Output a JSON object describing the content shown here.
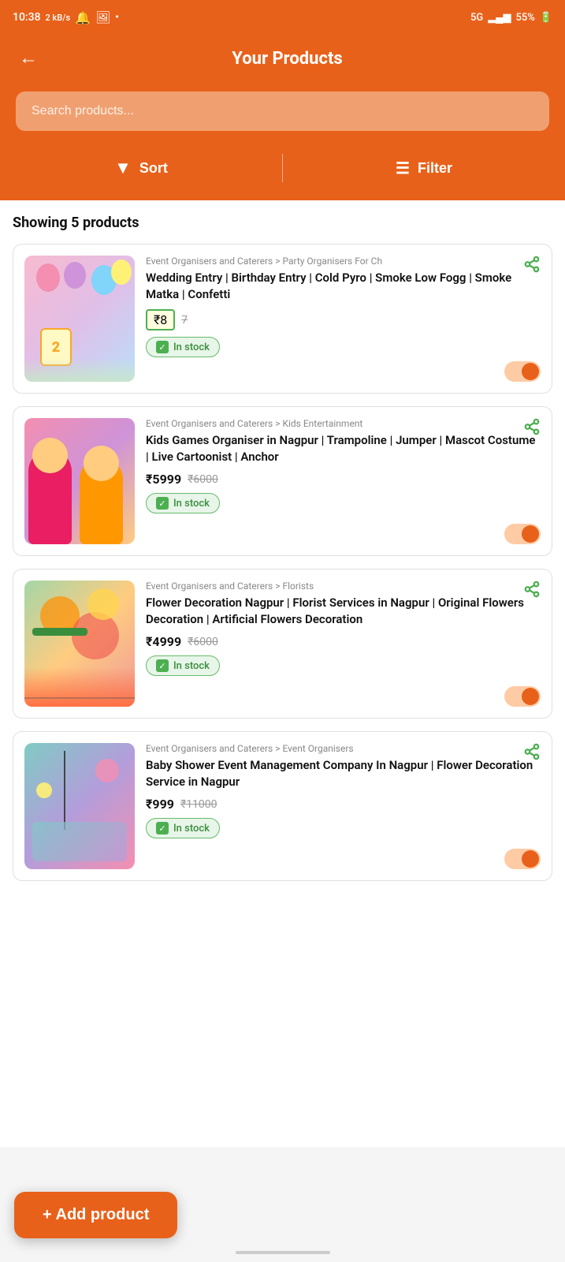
{
  "statusBar": {
    "time": "10:38",
    "network": "2 kB/s",
    "battery": "55%",
    "signal": "5G"
  },
  "header": {
    "backLabel": "←",
    "title": "Your Products"
  },
  "search": {
    "placeholder": "Search products..."
  },
  "toolbar": {
    "sortLabel": "Sort",
    "filterLabel": "Filter"
  },
  "products": {
    "showingLabel": "Showing 5 products",
    "items": [
      {
        "id": 1,
        "category": "Event Organisers and Caterers > Party Organisers For Ch",
        "title": "Wedding Entry | Birthday Entry | Cold Pyro | Smoke Low Fogg | Smoke Matka | Confetti",
        "price": "₹8",
        "originalPrice": "7",
        "priceHighlighted": true,
        "inStock": true,
        "toggleOn": true,
        "imageType": "wedding"
      },
      {
        "id": 2,
        "category": "Event Organisers and Caterers > Kids Entertainment",
        "title": "Kids Games Organiser in Nagpur | Trampoline | Jumper | Mascot Costume | Live Cartoonist | Anchor",
        "price": "₹5999",
        "originalPrice": "₹6000",
        "inStock": true,
        "toggleOn": true,
        "imageType": "kids"
      },
      {
        "id": 3,
        "category": "Event Organisers and Caterers > Florists",
        "title": "Flower Decoration Nagpur | Florist Services in Nagpur | Original Flowers Decoration | Artificial Flowers Decoration",
        "price": "₹4999",
        "originalPrice": "₹6000",
        "inStock": true,
        "toggleOn": true,
        "imageType": "flowers"
      },
      {
        "id": 4,
        "category": "Event Organisers and Caterers > Event Organisers",
        "title": "Baby Shower Event Management Company In Nagpur | Flower Decoration Service in Nagpur",
        "price": "₹999",
        "originalPrice": "₹11000",
        "inStock": true,
        "toggleOn": true,
        "imageType": "baby"
      }
    ]
  },
  "addProduct": {
    "label": "+ Add product"
  },
  "inStockLabel": "In stock",
  "shareIcon": "⎋",
  "colors": {
    "primary": "#E8611A",
    "inStockBg": "#e8f5e9",
    "inStockBorder": "#66bb6a"
  }
}
